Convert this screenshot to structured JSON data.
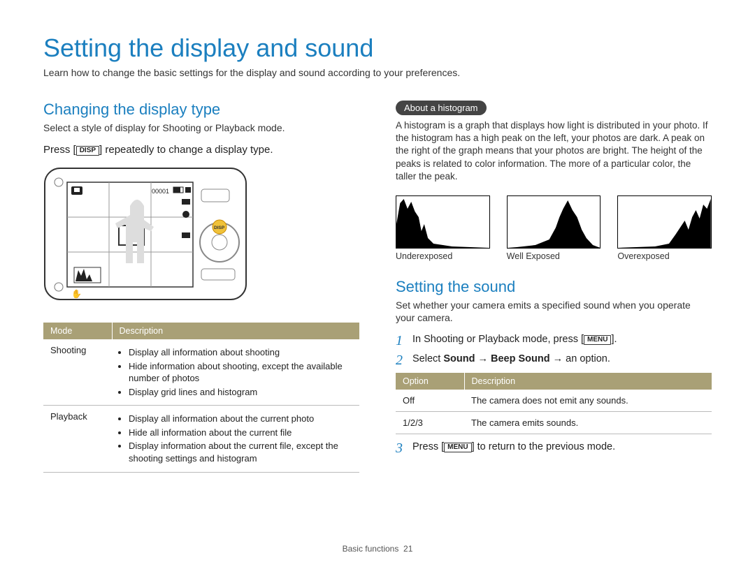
{
  "page": {
    "title": "Setting the display and sound",
    "intro": "Learn how to change the basic settings for the display and sound according to your preferences.",
    "footer_section": "Basic functions",
    "footer_page": "21"
  },
  "left": {
    "heading": "Changing the display type",
    "sub": "Select a style of display for Shooting or Playback mode.",
    "instr_pre": "Press [",
    "disp_key": "DISP",
    "instr_post": "] repeatedly to change a display type.",
    "table": {
      "head_mode": "Mode",
      "head_desc": "Description",
      "rows": [
        {
          "mode": "Shooting",
          "items": [
            "Display all information about shooting",
            "Hide information about shooting, except the available number of photos",
            "Display grid lines and histogram"
          ]
        },
        {
          "mode": "Playback",
          "items": [
            "Display all information about the current photo",
            "Hide all information about the current file",
            "Display information about the current file, except the shooting settings and histogram"
          ]
        }
      ]
    }
  },
  "right": {
    "hist_label": "About a histogram",
    "hist_body": "A histogram is a graph that displays how light is distributed in your photo. If the histogram has a high peak on the left, your photos are dark. A peak on the right of the graph means that your photos are bright. The height of the peaks is related to color information. The more of a particular color, the taller the peak.",
    "hist_caps": [
      "Underexposed",
      "Well Exposed",
      "Overexposed"
    ],
    "sound_heading": "Setting the sound",
    "sound_sub": "Set whether your camera emits a specified sound when you operate your camera.",
    "steps": {
      "s1_pre": "In Shooting or Playback mode, press [",
      "menu_key": "MENU",
      "s1_post": "].",
      "s2_pre": "Select ",
      "s2_b1": "Sound",
      "s2_arrow": " → ",
      "s2_b2": "Beep Sound",
      "s2_post": " → an option.",
      "s3_pre": "Press [",
      "s3_post": "] to return to the previous mode."
    },
    "opt_table": {
      "head_opt": "Option",
      "head_desc": "Description",
      "rows": [
        {
          "opt": "Off",
          "desc": "The camera does not emit any sounds."
        },
        {
          "opt": "1/2/3",
          "desc": "The camera emits sounds."
        }
      ]
    }
  },
  "chart_data": [
    {
      "type": "area",
      "title": "",
      "xlabel": "",
      "ylabel": "",
      "name": "Underexposed",
      "x": [
        0,
        5,
        10,
        15,
        20,
        25,
        28,
        30,
        35,
        40,
        60,
        80,
        100
      ],
      "y": [
        45,
        80,
        95,
        70,
        85,
        60,
        30,
        40,
        15,
        8,
        3,
        1,
        0
      ],
      "ylim": [
        0,
        100
      ]
    },
    {
      "type": "area",
      "title": "",
      "xlabel": "",
      "ylabel": "",
      "name": "Well Exposed",
      "x": [
        0,
        10,
        20,
        30,
        40,
        50,
        55,
        60,
        65,
        70,
        75,
        80,
        85,
        90,
        100
      ],
      "y": [
        0,
        2,
        4,
        6,
        8,
        15,
        30,
        55,
        70,
        95,
        65,
        50,
        25,
        10,
        2
      ],
      "ylim": [
        0,
        100
      ]
    },
    {
      "type": "area",
      "title": "",
      "xlabel": "",
      "ylabel": "",
      "name": "Overexposed",
      "x": [
        0,
        20,
        40,
        55,
        60,
        65,
        70,
        75,
        80,
        85,
        90,
        95,
        100
      ],
      "y": [
        0,
        1,
        3,
        5,
        15,
        25,
        40,
        30,
        55,
        70,
        60,
        85,
        95
      ],
      "ylim": [
        0,
        100
      ]
    }
  ]
}
